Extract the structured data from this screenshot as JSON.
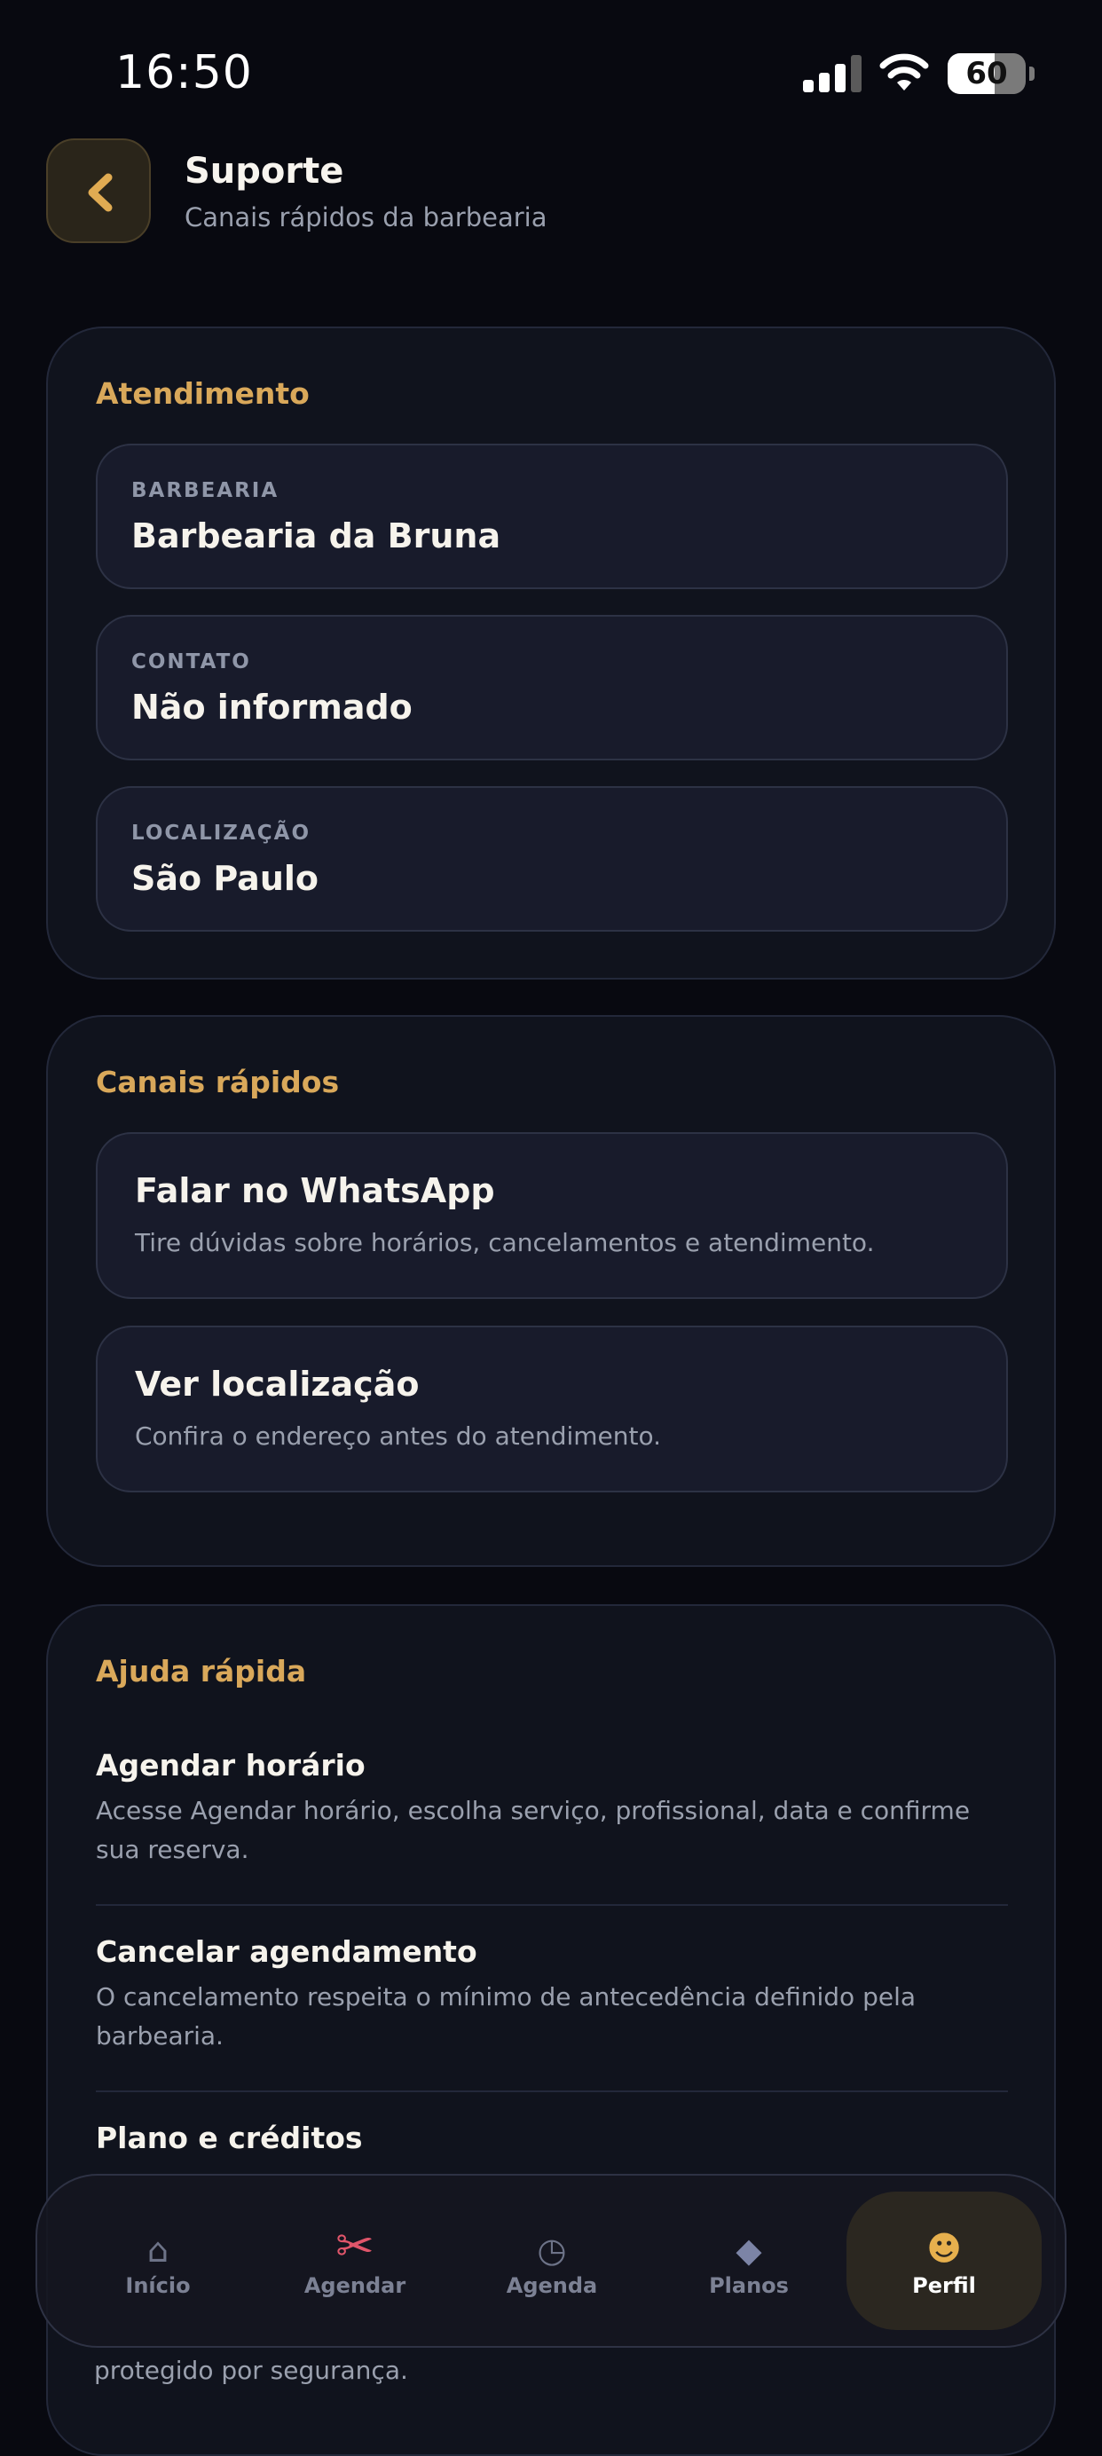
{
  "status_bar": {
    "time": "16:50",
    "battery": "60",
    "battery_level_pct": 60
  },
  "header": {
    "title": "Suporte",
    "subtitle": "Canais rápidos da barbearia"
  },
  "atendimento": {
    "title": "Atendimento",
    "items": [
      {
        "label": "BARBEARIA",
        "value": "Barbearia da Bruna"
      },
      {
        "label": "CONTATO",
        "value": "Não informado"
      },
      {
        "label": "LOCALIZAÇÃO",
        "value": "São Paulo"
      }
    ]
  },
  "canais": {
    "title": "Canais rápidos",
    "items": [
      {
        "title": "Falar no WhatsApp",
        "description": "Tire dúvidas sobre horários, cancelamentos e atendimento."
      },
      {
        "title": "Ver localização",
        "description": "Confira o endereço antes do atendimento."
      }
    ]
  },
  "ajuda": {
    "title": "Ajuda rápida",
    "items": [
      {
        "title": "Agendar horário",
        "description": "Acesse Agendar horário, escolha serviço, profissional, data e confirme sua reserva."
      },
      {
        "title": "Cancelar agendamento",
        "description": "O cancelamento respeita o mínimo de antecedência definido pela barbearia."
      },
      {
        "title": "Plano e créditos",
        "description": ""
      }
    ],
    "partial_text": "protegido por segurança."
  },
  "tab_bar": {
    "items": [
      {
        "label": "Início",
        "icon": "home-icon",
        "glyph": "⌂"
      },
      {
        "label": "Agendar",
        "icon": "scissors-icon",
        "glyph": "✂"
      },
      {
        "label": "Agenda",
        "icon": "clock-icon",
        "glyph": "◷"
      },
      {
        "label": "Planos",
        "icon": "diamond-icon",
        "glyph": "◆"
      },
      {
        "label": "Perfil",
        "icon": "smiley-icon",
        "glyph": "☻"
      }
    ],
    "active": "Perfil"
  },
  "colors": {
    "accent": "#d9a85a",
    "background": "#080910",
    "card": "#10131d",
    "scissors": "#e0556a"
  }
}
